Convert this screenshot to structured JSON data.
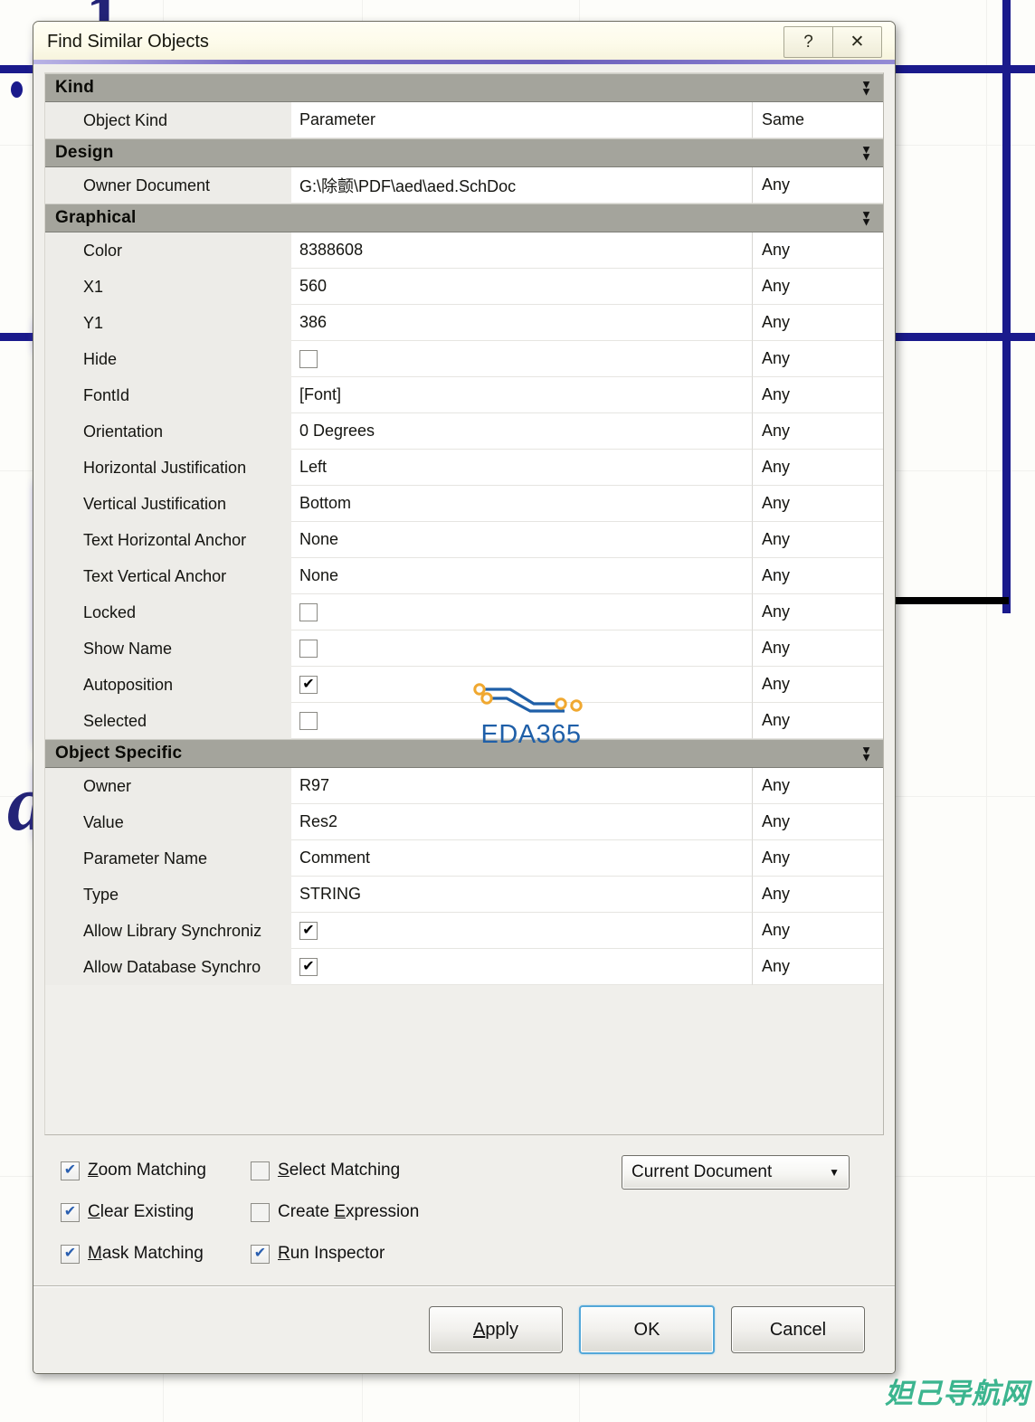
{
  "window": {
    "title": "Find Similar Objects",
    "help_button": "?",
    "close_button": "✕"
  },
  "groups": [
    {
      "name": "Kind",
      "chevron": "chevron-down-double",
      "rows": [
        {
          "label": "Object Kind",
          "value": "Parameter",
          "type": "text",
          "match": "Same"
        }
      ]
    },
    {
      "name": "Design",
      "chevron": "chevron-down-double",
      "rows": [
        {
          "label": "Owner Document",
          "value": "G:\\除颤\\PDF\\aed\\aed.SchDoc",
          "type": "text",
          "match": "Any"
        }
      ]
    },
    {
      "name": "Graphical",
      "chevron": "chevron-down-double",
      "rows": [
        {
          "label": "Color",
          "value": "8388608",
          "type": "text",
          "match": "Any"
        },
        {
          "label": "X1",
          "value": "560",
          "type": "text",
          "match": "Any"
        },
        {
          "label": "Y1",
          "value": "386",
          "type": "text",
          "match": "Any"
        },
        {
          "label": "Hide",
          "value": "",
          "type": "checkbox",
          "checked": false,
          "match": "Any"
        },
        {
          "label": "FontId",
          "value": "[Font]",
          "type": "text",
          "match": "Any"
        },
        {
          "label": "Orientation",
          "value": "0 Degrees",
          "type": "text",
          "match": "Any"
        },
        {
          "label": "Horizontal Justification",
          "value": "Left",
          "type": "text",
          "match": "Any"
        },
        {
          "label": "Vertical Justification",
          "value": "Bottom",
          "type": "text",
          "match": "Any"
        },
        {
          "label": "Text Horizontal Anchor",
          "value": "None",
          "type": "text",
          "match": "Any"
        },
        {
          "label": "Text Vertical Anchor",
          "value": "None",
          "type": "text",
          "match": "Any"
        },
        {
          "label": "Locked",
          "value": "",
          "type": "checkbox",
          "checked": false,
          "match": "Any"
        },
        {
          "label": "Show Name",
          "value": "",
          "type": "checkbox",
          "checked": false,
          "match": "Any"
        },
        {
          "label": "Autoposition",
          "value": "",
          "type": "checkbox",
          "checked": true,
          "match": "Any"
        },
        {
          "label": "Selected",
          "value": "",
          "type": "checkbox",
          "checked": false,
          "match": "Any"
        }
      ]
    },
    {
      "name": "Object Specific",
      "chevron": "chevron-down-double",
      "rows": [
        {
          "label": "Owner",
          "value": "R97",
          "type": "text",
          "match": "Any"
        },
        {
          "label": "Value",
          "value": "Res2",
          "type": "text",
          "match": "Any"
        },
        {
          "label": "Parameter Name",
          "value": "Comment",
          "type": "text",
          "match": "Any"
        },
        {
          "label": "Type",
          "value": "STRING",
          "type": "text",
          "match": "Any"
        },
        {
          "label": "Allow Library Synchroniz",
          "value": "",
          "type": "checkbox",
          "checked": true,
          "match": "Any"
        },
        {
          "label": "Allow Database Synchro",
          "value": "",
          "type": "checkbox",
          "checked": true,
          "match": "Any"
        }
      ]
    }
  ],
  "options": [
    {
      "label_accel": "Z",
      "label_rest": "oom Matching",
      "checked": true
    },
    {
      "label_accel": "S",
      "label_rest": "elect Matching",
      "checked": false
    },
    {
      "label_accel": "C",
      "label_rest": "lear Existing",
      "checked": true
    },
    {
      "label_pre": "Create ",
      "label_accel": "E",
      "label_rest": "xpression",
      "checked": false
    },
    {
      "label_accel": "M",
      "label_rest": "ask Matching",
      "checked": true
    },
    {
      "label_accel": "R",
      "label_rest": "un Inspector",
      "checked": true
    }
  ],
  "scope": {
    "value": "Current Document",
    "arrow": "▼"
  },
  "footer": {
    "apply_accel": "A",
    "apply_rest": "pply",
    "ok": "OK",
    "cancel": "Cancel"
  },
  "watermarks": {
    "logo_text": "EDA365",
    "site_text": "妲己导航网"
  },
  "colors": {
    "group_header": "#a4a49c",
    "wire": "#1a1a8c",
    "selection_glow": "#7a6ce0",
    "logo_blue": "#1f5fa8",
    "logo_orange": "#f0a830",
    "site_green": "#3cb58f",
    "focus_blue": "#53a7d8"
  }
}
